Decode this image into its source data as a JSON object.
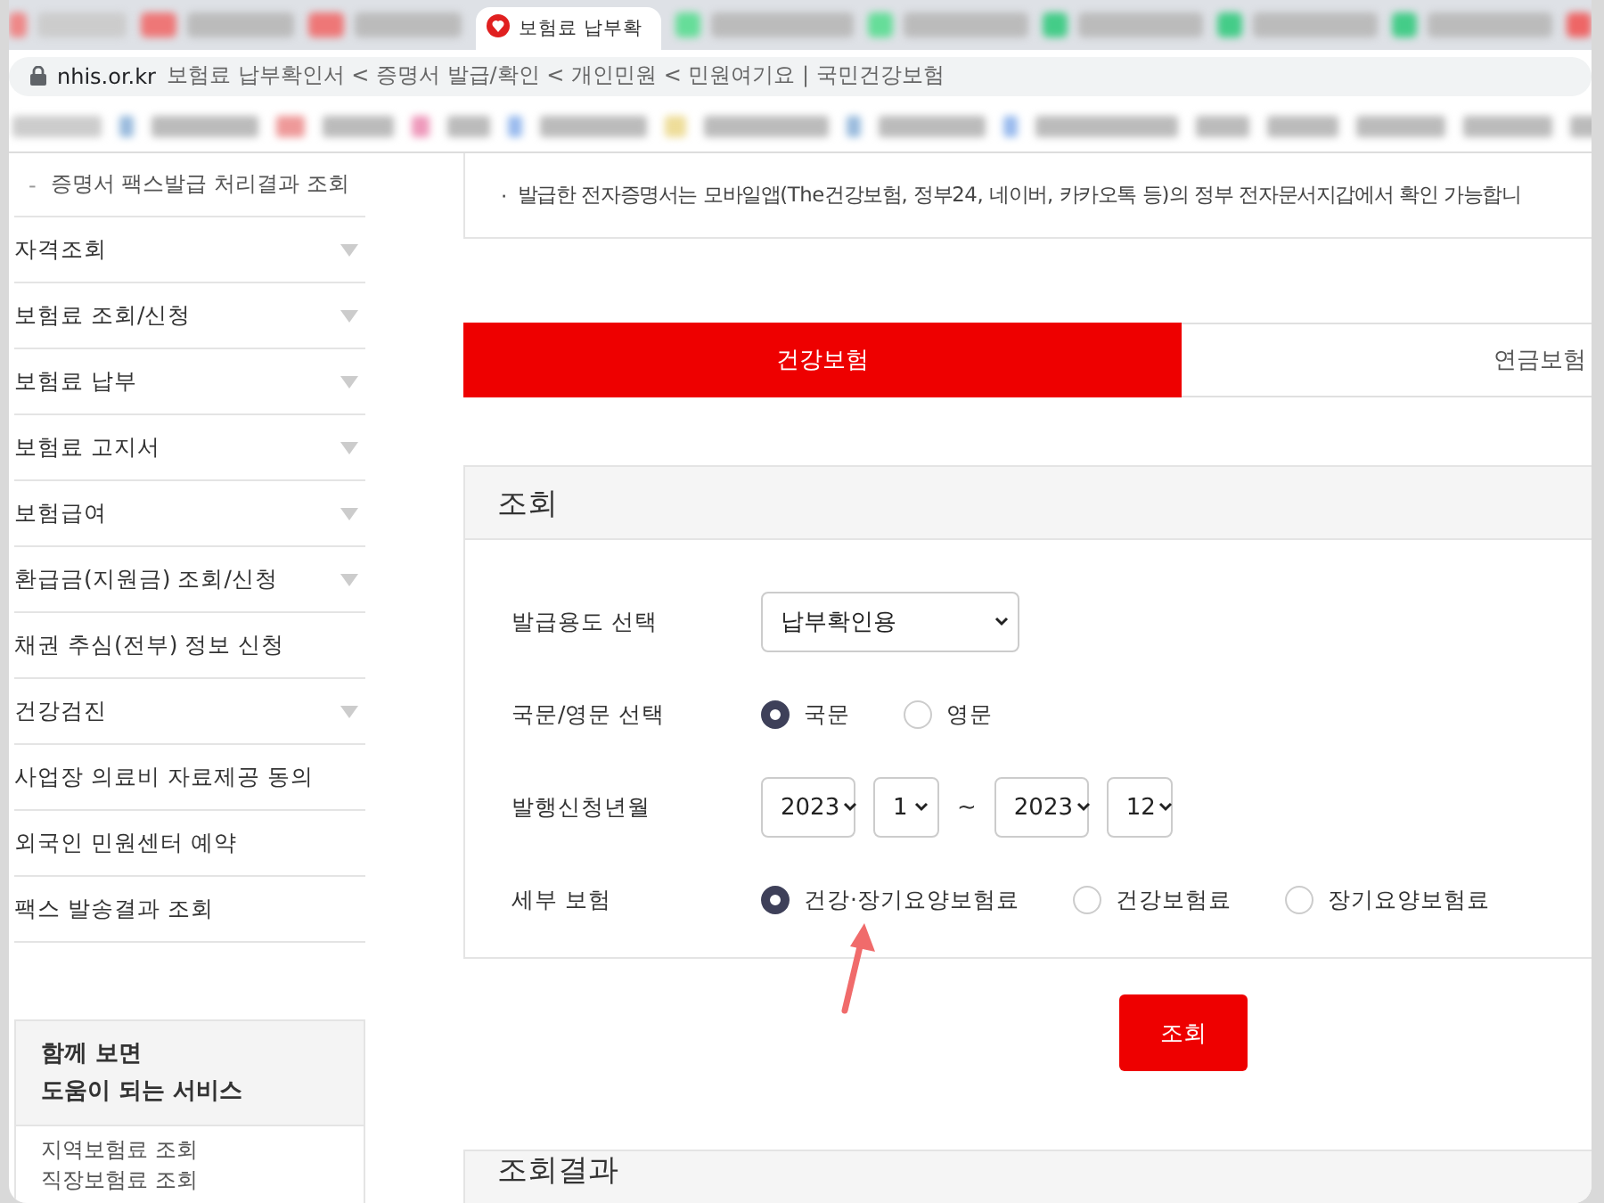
{
  "browser": {
    "active_tab": {
      "title": "보험료 납부확"
    },
    "address": {
      "domain": "nhis.or.kr",
      "title": "보험료 납부확인서 < 증명서 발급/확인 < 개인민원 < 민원여기요 | 국민건강보험"
    }
  },
  "sidebar": {
    "sub_item": {
      "marker": "-",
      "label": "증명서 팩스발급 처리결과 조회"
    },
    "items": [
      {
        "label": "자격조회",
        "expandable": true
      },
      {
        "label": "보험료 조회/신청",
        "expandable": true
      },
      {
        "label": "보험료 납부",
        "expandable": true
      },
      {
        "label": "보험료 고지서",
        "expandable": true
      },
      {
        "label": "보험급여",
        "expandable": true
      },
      {
        "label": "환급금(지원금) 조회/신청",
        "expandable": true
      },
      {
        "label": "채권 추심(전부) 정보 신청",
        "expandable": false
      },
      {
        "label": "건강검진",
        "expandable": true
      },
      {
        "label": "사업장 의료비 자료제공 동의",
        "expandable": false
      },
      {
        "label": "외국인 민원센터 예약",
        "expandable": false
      },
      {
        "label": "팩스 발송결과 조회",
        "expandable": false
      }
    ],
    "related": {
      "title": "함께 보면\n도움이 되는 서비스",
      "links": [
        "지역보험료 조회",
        "직장보험료 조회"
      ]
    }
  },
  "notice": {
    "bullet": "·",
    "text": "발급한 전자증명서는 모바일앱(The건강보험, 정부24, 네이버, 카카오톡 등)의 정부 전자문서지갑에서 확인 가능합니"
  },
  "tabs": [
    {
      "label": "건강보험",
      "selected": true
    },
    {
      "label": "연금보험",
      "selected": false
    }
  ],
  "query": {
    "title": "조회",
    "rows": [
      {
        "kind": "select",
        "label": "발급용도 선택",
        "selects": [
          {
            "value": "납부확인용"
          }
        ]
      },
      {
        "kind": "radio",
        "label": "국문/영문 선택",
        "options": [
          {
            "label": "국문",
            "selected": true
          },
          {
            "label": "영문",
            "selected": false
          }
        ]
      },
      {
        "kind": "period",
        "label": "발행신청년월",
        "selects": [
          {
            "value": "2023"
          },
          {
            "value": "1"
          },
          {
            "value": "2023"
          },
          {
            "value": "12"
          }
        ],
        "separator": "~"
      },
      {
        "kind": "radio",
        "label": "세부 보험",
        "options": [
          {
            "label": "건강·장기요양보험료",
            "selected": true
          },
          {
            "label": "건강보험료",
            "selected": false
          },
          {
            "label": "장기요양보험료",
            "selected": false
          }
        ]
      }
    ],
    "button": "조회"
  },
  "result": {
    "title": "조회결과"
  }
}
